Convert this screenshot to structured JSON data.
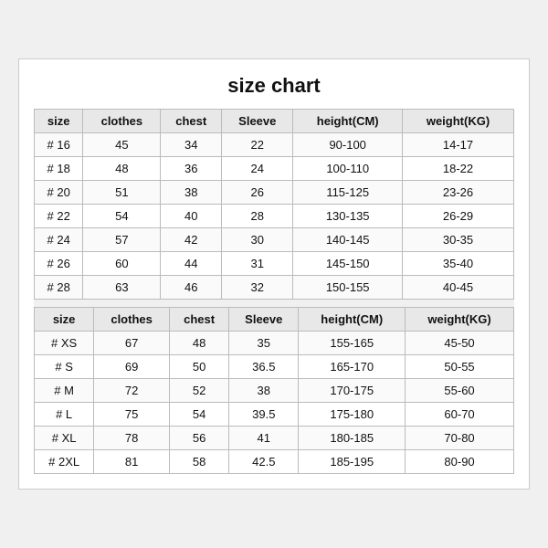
{
  "title": "size chart",
  "columns": [
    "size",
    "clothes",
    "chest",
    "Sleeve",
    "height(CM)",
    "weight(KG)"
  ],
  "table1": [
    [
      "# 16",
      "45",
      "34",
      "22",
      "90-100",
      "14-17"
    ],
    [
      "# 18",
      "48",
      "36",
      "24",
      "100-110",
      "18-22"
    ],
    [
      "# 20",
      "51",
      "38",
      "26",
      "115-125",
      "23-26"
    ],
    [
      "# 22",
      "54",
      "40",
      "28",
      "130-135",
      "26-29"
    ],
    [
      "# 24",
      "57",
      "42",
      "30",
      "140-145",
      "30-35"
    ],
    [
      "# 26",
      "60",
      "44",
      "31",
      "145-150",
      "35-40"
    ],
    [
      "# 28",
      "63",
      "46",
      "32",
      "150-155",
      "40-45"
    ]
  ],
  "table2": [
    [
      "# XS",
      "67",
      "48",
      "35",
      "155-165",
      "45-50"
    ],
    [
      "# S",
      "69",
      "50",
      "36.5",
      "165-170",
      "50-55"
    ],
    [
      "# M",
      "72",
      "52",
      "38",
      "170-175",
      "55-60"
    ],
    [
      "# L",
      "75",
      "54",
      "39.5",
      "175-180",
      "60-70"
    ],
    [
      "# XL",
      "78",
      "56",
      "41",
      "180-185",
      "70-80"
    ],
    [
      "# 2XL",
      "81",
      "58",
      "42.5",
      "185-195",
      "80-90"
    ]
  ]
}
